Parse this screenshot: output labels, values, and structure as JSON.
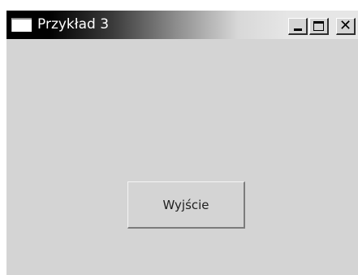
{
  "window": {
    "title": "Przykład 3",
    "icon": "window-icon",
    "controls": {
      "minimize": {
        "icon": "minimize-icon"
      },
      "maximize": {
        "icon": "maximize-icon"
      },
      "close": {
        "icon": "close-icon",
        "glyph": "✕"
      }
    }
  },
  "main": {
    "exit_button_label": "Wyjście"
  },
  "colors": {
    "client_background": "#d4d4d4",
    "titlebar_start": "#000000",
    "titlebar_end": "#e6e6e6",
    "title_text": "#ffffff"
  }
}
